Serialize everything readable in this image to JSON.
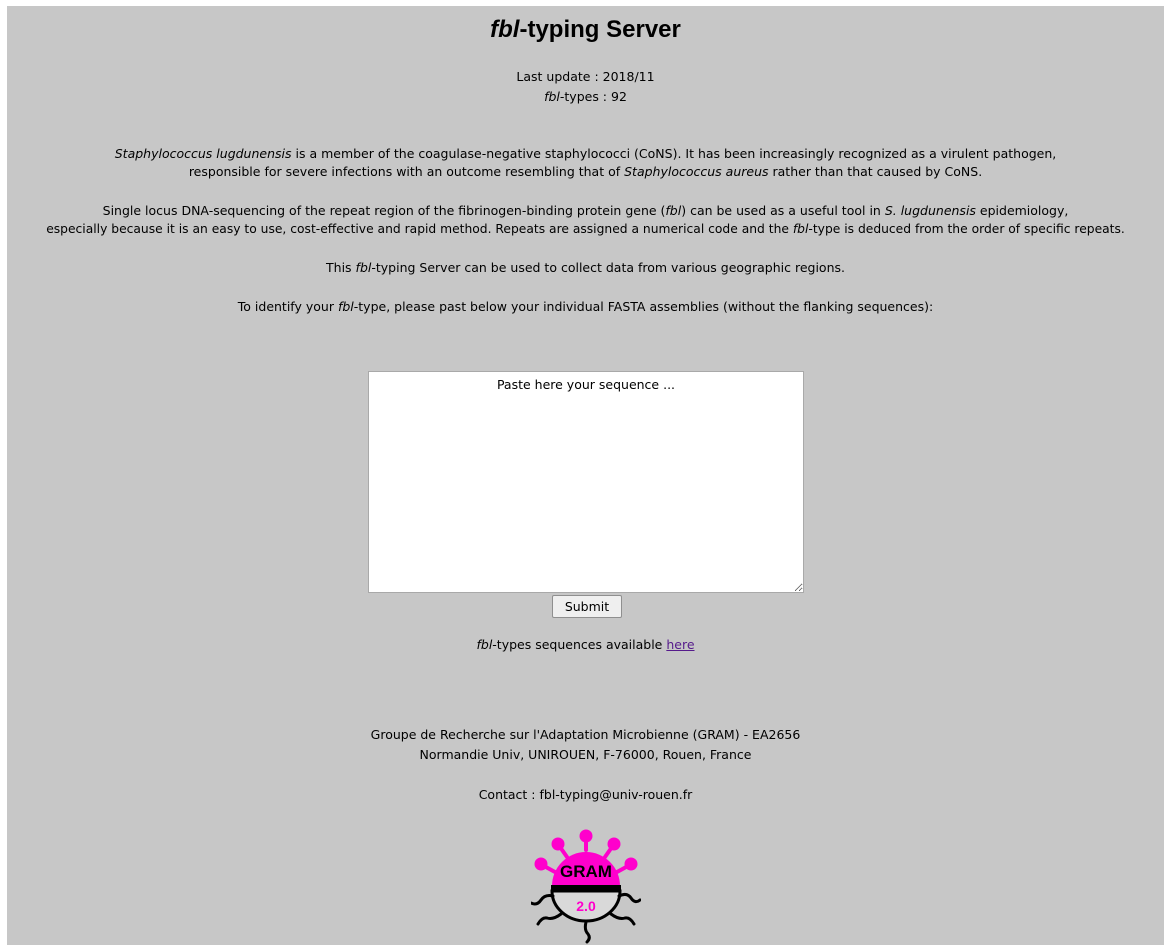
{
  "header": {
    "title_italic": "fbl",
    "title_rest": "-typing Server",
    "last_update": "Last update : 2018/11",
    "types_italic": "fbl",
    "types_rest": "-types : 92"
  },
  "intro": {
    "p1_species": "Staphylococcus lugdunensis",
    "p1_a": " is a member of the coagulase-negative staphylococci (CoNS). It has been increasingly recognized as a virulent pathogen,",
    "p1_b": "responsible for severe infections with an outcome resembling that of ",
    "p1_species2": "Staphylococcus aureus",
    "p1_c": " rather than that caused by CoNS.",
    "p2_a": "Single locus DNA-sequencing of the repeat region of the fibrinogen-binding protein gene (",
    "p2_gene": "fbl",
    "p2_b": ") can be used as a useful tool in ",
    "p2_species": "S. lugdunensis",
    "p2_c": " epidemiology,",
    "p2_d": "especially because it is an easy to use, cost-effective and rapid method. Repeats are assigned a numerical code and the ",
    "p2_gene2": "fbl",
    "p2_e": "-type is deduced from the order of specific repeats.",
    "p3_a": "This ",
    "p3_gene": "fbl",
    "p3_b": "-typing Server can be used to collect data from various geographic regions.",
    "p4_a": "To identify your ",
    "p4_gene": "fbl",
    "p4_b": "-type, please past below your individual FASTA assemblies (without the flanking sequences):"
  },
  "form": {
    "placeholder": "Paste here your sequence ...",
    "submit_label": "Submit"
  },
  "sequences": {
    "gene": "fbl",
    "text": "-types sequences available ",
    "link_label": "here"
  },
  "footer": {
    "line1": "Groupe de Recherche sur l'Adaptation Microbienne (GRAM) - EA2656",
    "line2": "Normandie Univ, UNIROUEN, F-76000, Rouen, France",
    "contact": "Contact : fbl-typing@univ-rouen.fr"
  },
  "logo": {
    "top_text": "GRAM",
    "bottom_text": "2.0",
    "pink": "#ff00cc",
    "icon": "gram-logo-icon"
  }
}
